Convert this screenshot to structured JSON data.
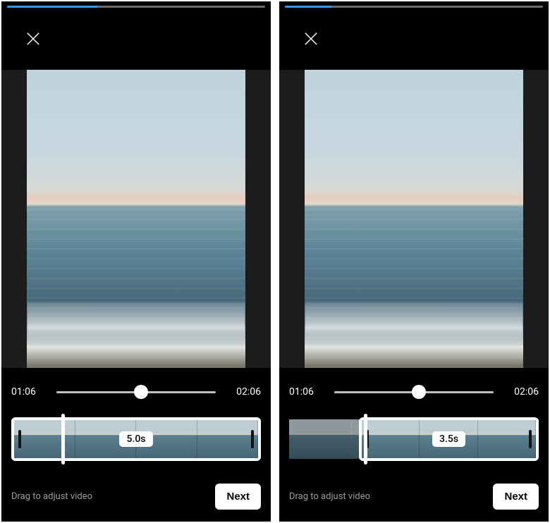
{
  "screens": [
    {
      "progress_percent": 35,
      "seek": {
        "start": "01:06",
        "end": "02:06",
        "thumb_percent": 53
      },
      "selection": {
        "left_percent": 0,
        "width_percent": 100,
        "duration_label": "5.0s",
        "playhead_percent": 20
      },
      "hint": "Drag to adjust video",
      "next_label": "Next"
    },
    {
      "progress_percent": 18,
      "seek": {
        "start": "01:06",
        "end": "02:06",
        "thumb_percent": 53
      },
      "selection": {
        "left_percent": 28,
        "width_percent": 72,
        "duration_label": "3.5s",
        "playhead_percent": 30
      },
      "hint": "Drag to adjust video",
      "next_label": "Next"
    }
  ]
}
